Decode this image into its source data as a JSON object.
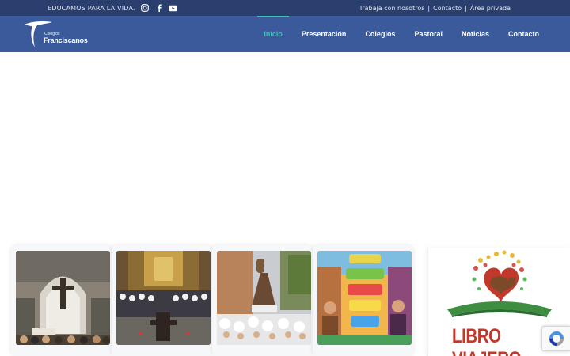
{
  "topbar": {
    "slogan": "EDUCAMOS PARA LA VIDA.",
    "social_icons": [
      "instagram-icon",
      "facebook-icon",
      "youtube-icon"
    ],
    "links": [
      {
        "label": "Trabaja con nosotros"
      },
      {
        "label": "Contacto"
      },
      {
        "label": "Área privada"
      }
    ],
    "separator": "|"
  },
  "logo": {
    "small": "Colegios",
    "big": "Franciscanos"
  },
  "nav": {
    "items": [
      {
        "label": "Inicio",
        "active": true
      },
      {
        "label": "Presentación",
        "active": false
      },
      {
        "label": "Colegios",
        "active": false
      },
      {
        "label": "Pastoral",
        "active": false
      },
      {
        "label": "Noticias",
        "active": false
      },
      {
        "label": "Contacto",
        "active": false
      }
    ]
  },
  "side_banner": {
    "title": "LIBRO VIAJERO"
  },
  "colors": {
    "topbar": "#2a3f6e",
    "navbar": "#3a5a9c",
    "accent": "#3ec1b0",
    "banner_red": "#c0392b"
  },
  "icons": {
    "recaptcha": "recaptcha-icon"
  }
}
